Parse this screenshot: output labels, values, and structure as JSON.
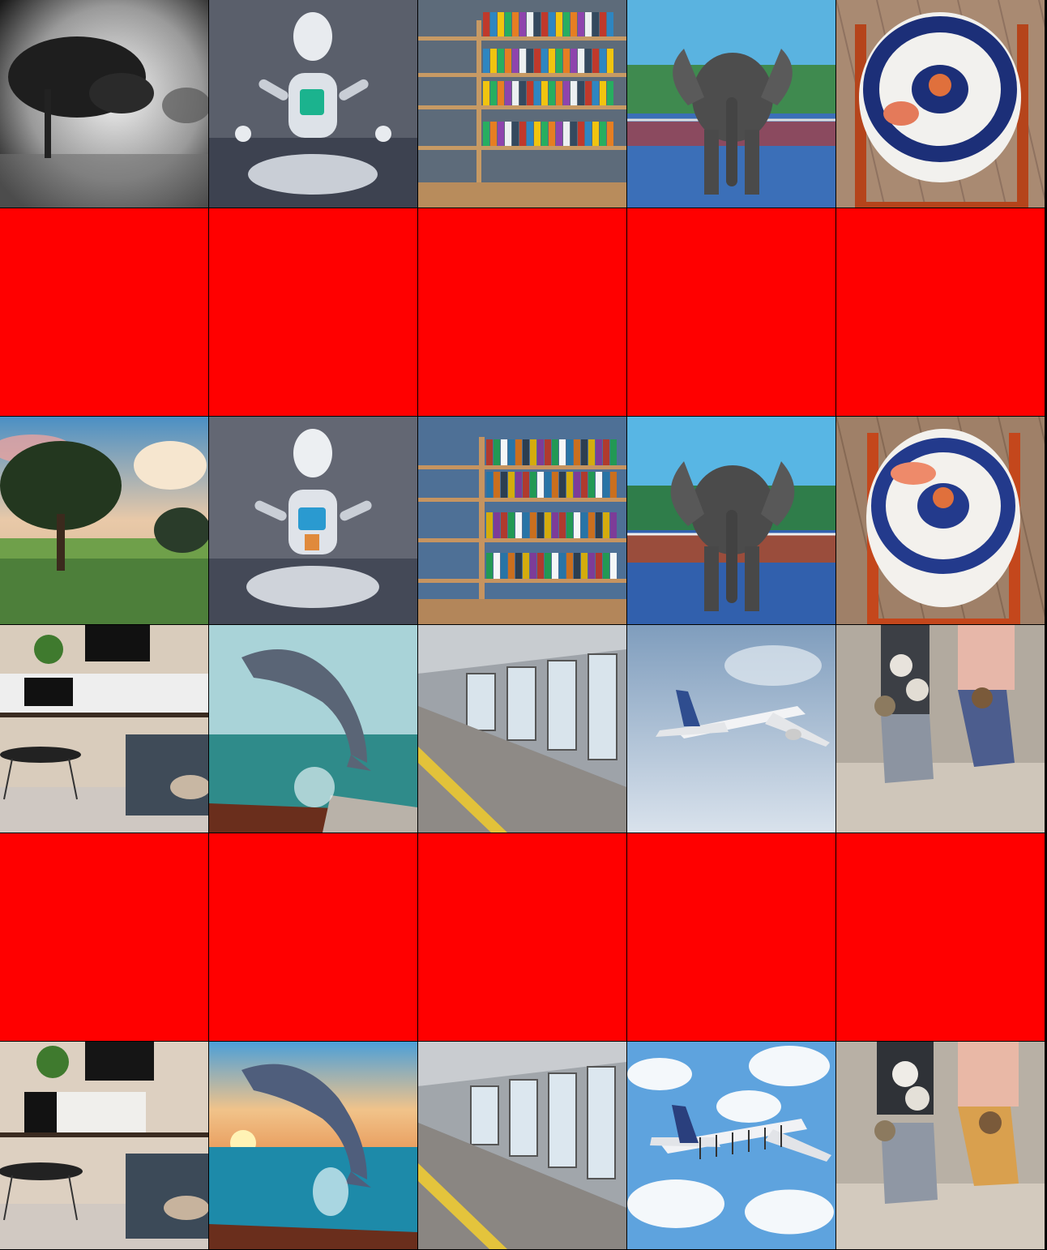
{
  "grid": {
    "columns": 5,
    "rows": 6,
    "cells": [
      {
        "kind": "image",
        "icon": "foggy-tree-icon",
        "scene": "foggy-tree"
      },
      {
        "kind": "image",
        "icon": "robot-icon",
        "scene": "robot"
      },
      {
        "kind": "image",
        "icon": "bookshelf-icon",
        "scene": "bookshelf"
      },
      {
        "kind": "image",
        "icon": "elephant-icon",
        "scene": "elephant"
      },
      {
        "kind": "image",
        "icon": "porcelain-stool-icon",
        "scene": "porcelain"
      },
      {
        "kind": "placeholder",
        "color": "#ff0000"
      },
      {
        "kind": "placeholder",
        "color": "#ff0000"
      },
      {
        "kind": "placeholder",
        "color": "#ff0000"
      },
      {
        "kind": "placeholder",
        "color": "#ff0000"
      },
      {
        "kind": "placeholder",
        "color": "#ff0000"
      },
      {
        "kind": "image",
        "icon": "anime-tree-icon",
        "scene": "anime-tree"
      },
      {
        "kind": "image",
        "icon": "robot-icon",
        "scene": "robot2"
      },
      {
        "kind": "image",
        "icon": "bookshelf-icon",
        "scene": "bookshelf2"
      },
      {
        "kind": "image",
        "icon": "elephant-icon",
        "scene": "elephant2"
      },
      {
        "kind": "image",
        "icon": "porcelain-stool-icon",
        "scene": "porcelain2"
      },
      {
        "kind": "image",
        "icon": "living-room-icon",
        "scene": "living-room"
      },
      {
        "kind": "image",
        "icon": "dolphin-icon",
        "scene": "dolphin"
      },
      {
        "kind": "image",
        "icon": "subway-train-icon",
        "scene": "train"
      },
      {
        "kind": "image",
        "icon": "airplane-icon",
        "scene": "plane"
      },
      {
        "kind": "image",
        "icon": "cat-socks-icon",
        "scene": "socks"
      },
      {
        "kind": "placeholder",
        "color": "#ff0000"
      },
      {
        "kind": "placeholder",
        "color": "#ff0000"
      },
      {
        "kind": "placeholder",
        "color": "#ff0000"
      },
      {
        "kind": "placeholder",
        "color": "#ff0000"
      },
      {
        "kind": "placeholder",
        "color": "#ff0000"
      },
      {
        "kind": "image",
        "icon": "living-room-icon",
        "scene": "living-room2"
      },
      {
        "kind": "image",
        "icon": "dolphin-icon",
        "scene": "dolphin2"
      },
      {
        "kind": "image",
        "icon": "subway-train-icon",
        "scene": "train2"
      },
      {
        "kind": "image",
        "icon": "airplane-icon",
        "scene": "plane2"
      },
      {
        "kind": "image",
        "icon": "cat-socks-icon",
        "scene": "socks2"
      }
    ]
  }
}
